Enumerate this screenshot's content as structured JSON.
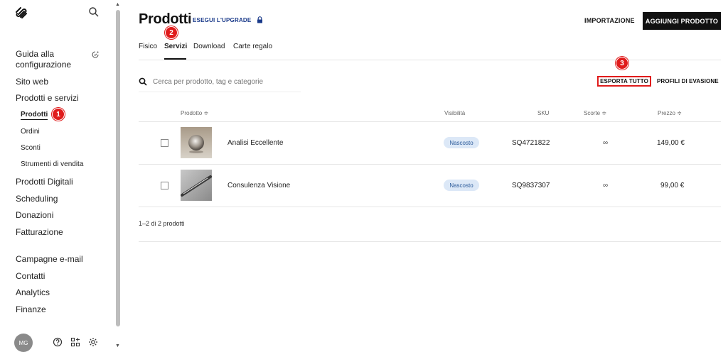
{
  "sidebar": {
    "nav_main": [
      "Guida alla",
      "configurazione",
      "Sito web",
      "Prodotti e servizi"
    ],
    "nav_sub": [
      "Prodotti",
      "Ordini",
      "Sconti",
      "Strumenti di vendita"
    ],
    "nav_rest": [
      "Prodotti Digitali",
      "Scheduling",
      "Donazioni",
      "Fatturazione",
      "Campagne e-mail",
      "Contatti",
      "Analytics",
      "Finanze"
    ],
    "avatar_initials": "MG"
  },
  "header": {
    "title": "Prodotti",
    "upgrade_label": "ESEGUI L'UPGRADE",
    "import_label": "IMPORTAZIONE",
    "add_label": "AGGIUNGI PRODOTTO"
  },
  "tabs": [
    "Fisico",
    "Servizi",
    "Download",
    "Carte regalo"
  ],
  "active_tab": "Servizi",
  "toolbar": {
    "search_placeholder": "Cerca per prodotto, tag e categorie",
    "export_label": "ESPORTA TUTTO",
    "profiles_label": "PROFILI DI EVASIONE"
  },
  "table": {
    "headers": {
      "product": "Prodotto ≑",
      "visibility": "Visibilità",
      "sku": "SKU",
      "stock": "Scorte ≑",
      "price": "Prezzo ≑"
    },
    "rows": [
      {
        "name": "Analisi Eccellente",
        "visibility": "Nascosto",
        "sku": "SQ4721822",
        "stock": "∞",
        "price": "149,00 €"
      },
      {
        "name": "Consulenza Visione",
        "visibility": "Nascosto",
        "sku": "SQ9837307",
        "stock": "∞",
        "price": "99,00 €"
      }
    ]
  },
  "pagination": "1–2 di 2 prodotti",
  "badges": [
    "1",
    "2",
    "3"
  ],
  "colors": {
    "accent": "#1a3a8a",
    "badge": "#e01b1b",
    "primary_button": "#111111",
    "pill_bg": "#dce8f7"
  },
  "icons": [
    "squarespace-logo-icon",
    "search-icon",
    "guide-progress-icon",
    "lock-icon",
    "help-icon",
    "add-block-icon",
    "settings-icon"
  ]
}
